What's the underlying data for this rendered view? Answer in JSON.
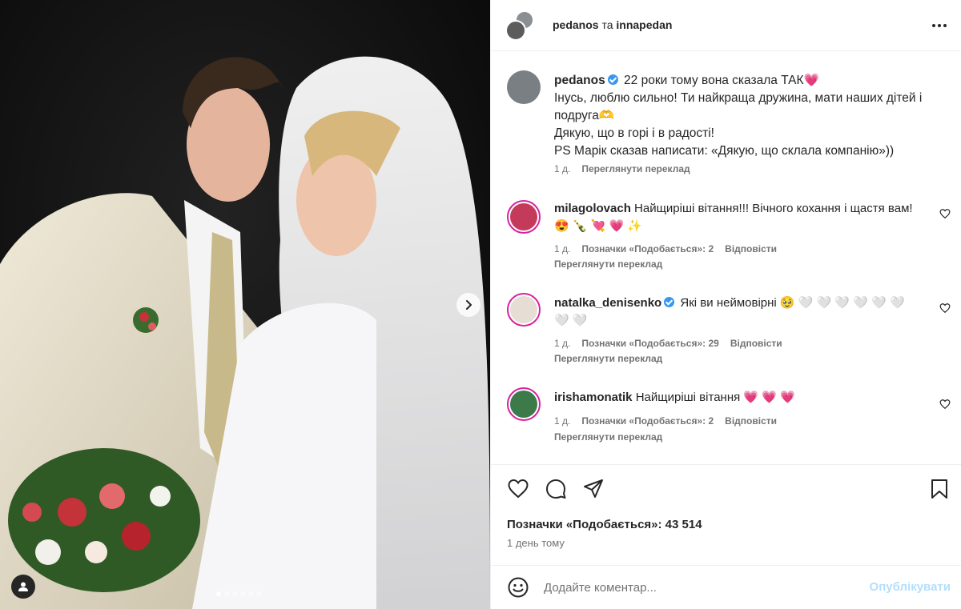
{
  "header": {
    "user1": "pedanos",
    "conj": "та",
    "user2": "innapedan"
  },
  "caption": {
    "username": "pedanos",
    "lines": [
      "22 роки тому вона сказала ТАК",
      "Інусь, люблю сильно! Ти найкраща дружина, мати наших дітей і подруга",
      "Дякую, що в горі і в радості!",
      "PS Марік сказав написати: «Дякую, що склала компанію»))"
    ],
    "emoji_heart": "💗",
    "emoji_hands": "🫶",
    "time": "1 д.",
    "translate": "Переглянути переклад"
  },
  "comments": [
    {
      "username": "milagolovach",
      "text": "Найщиріші вітання!!! Вічного кохання і щастя вам! 😍 🍾 💘 💗 ✨",
      "time": "1 д.",
      "likes": "Позначки «Подобається»: 2",
      "reply": "Відповісти",
      "translate": "Переглянути переклад"
    },
    {
      "username": "natalka_denisenko",
      "text": "Які ви неймовірні 🥹 🤍 🤍 🤍 🤍 🤍 🤍 🤍 🤍",
      "time": "1 д.",
      "likes": "Позначки «Подобається»: 29",
      "reply": "Відповісти",
      "translate": "Переглянути переклад"
    },
    {
      "username": "irishamonatik",
      "text": "Найщиріші вітання 💗 💗 💗",
      "time": "1 д.",
      "likes": "Позначки «Подобається»: 2",
      "reply": "Відповісти",
      "translate": "Переглянути переклад"
    }
  ],
  "stats": {
    "likes": "Позначки «Подобається»: 43 514",
    "date": "1 день тому"
  },
  "composer": {
    "placeholder": "Додайте коментар...",
    "publish": "Опублікувати"
  },
  "carousel": {
    "slide_count": 6,
    "active_slide": 1
  },
  "colors": {
    "accent": "#0095f6",
    "publish_disabled": "#b2dffc",
    "verified": "#3897f0",
    "muted": "#737373"
  },
  "icons": [
    "more-icon",
    "heart-icon",
    "comment-icon",
    "share-icon",
    "bookmark-icon",
    "emoji-icon",
    "chevron-right-icon",
    "user-tag-icon",
    "verified-icon"
  ]
}
